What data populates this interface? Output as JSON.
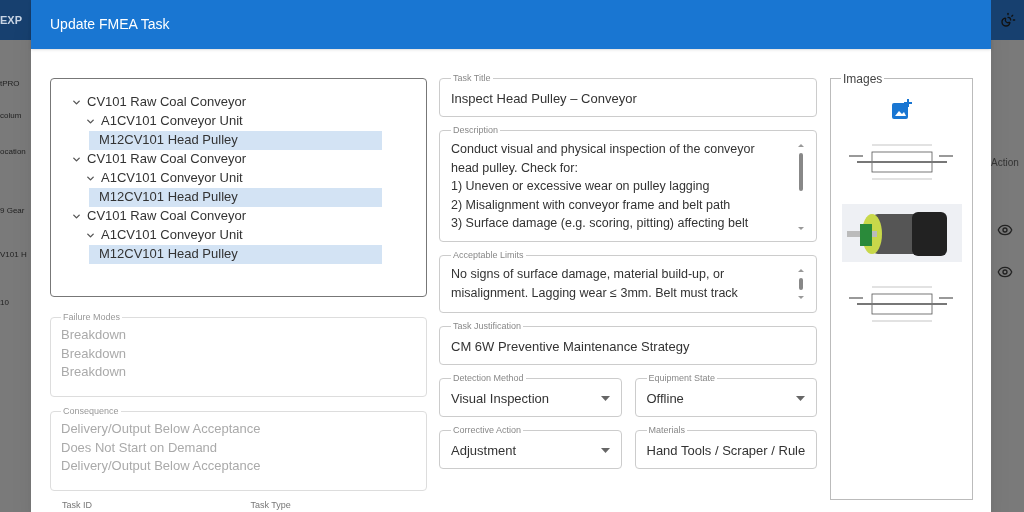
{
  "background": {
    "header_text": "EXP",
    "left_texts": [
      "tPRO",
      "colum",
      "ocation",
      "9 Gear",
      "V101 H",
      "10"
    ],
    "right_texts": [
      "Action"
    ]
  },
  "dialog": {
    "title": "Update FMEA Task"
  },
  "tree": [
    {
      "label": "CV101 Raw Coal Conveyor",
      "expanded": true,
      "selected": false,
      "children": [
        {
          "label": "A1CV101 Conveyor Unit",
          "expanded": true,
          "selected": false,
          "children": [
            {
              "label": "M12CV101 Head Pulley",
              "selected": true
            }
          ]
        }
      ]
    },
    {
      "label": "CV101 Raw Coal Conveyor",
      "expanded": true,
      "selected": false,
      "children": [
        {
          "label": "A1CV101 Conveyor Unit",
          "expanded": true,
          "selected": false,
          "children": [
            {
              "label": "M12CV101 Head Pulley",
              "selected": true
            }
          ]
        }
      ]
    },
    {
      "label": "CV101 Raw Coal Conveyor",
      "expanded": true,
      "selected": false,
      "children": [
        {
          "label": "A1CV101 Conveyor Unit",
          "expanded": true,
          "selected": false,
          "children": [
            {
              "label": "M12CV101 Head Pulley",
              "selected": true
            }
          ]
        }
      ]
    }
  ],
  "failure_modes": {
    "label": "Failure Modes",
    "disabled": true,
    "items": [
      "Breakdown",
      "Breakdown",
      "Breakdown"
    ]
  },
  "consequence": {
    "label": "Consequence",
    "disabled": true,
    "items": [
      "Delivery/Output Below Acceptance",
      "Does Not Start on Demand",
      "Delivery/Output Below Acceptance"
    ]
  },
  "bottom_labels": [
    "Task ID",
    "Task Type"
  ],
  "field_rows": [
    [
      {
        "kind": "text",
        "label": "Task Title",
        "value": "Inspect Head Pulley – Conveyor"
      }
    ],
    [
      {
        "kind": "textarea",
        "label": "Description",
        "lines": [
          "Conduct visual and physical inspection of the conveyor",
          "head pulley. Check for:",
          "1) Uneven or excessive wear on pulley lagging",
          "2) Misalignment with conveyor frame and belt path",
          "3) Surface damage (e.g. scoring, pitting) affecting belt"
        ]
      }
    ],
    [
      {
        "kind": "textarea",
        "label": "Acceptable Limits",
        "lines": [
          "No signs of surface damage, material build-up, or",
          "misalignment. Lagging wear ≤ 3mm. Belt must track"
        ]
      }
    ],
    [
      {
        "kind": "text",
        "label": "Task Justification",
        "value": "CM 6W Preventive Maintenance Strategy"
      }
    ],
    [
      {
        "kind": "select",
        "label": "Detection Method",
        "value": "Visual Inspection"
      },
      {
        "kind": "select",
        "label": "Equipment State",
        "value": "Offline"
      }
    ],
    [
      {
        "kind": "select",
        "label": "Corrective Action",
        "value": "Adjustment"
      },
      {
        "kind": "text",
        "label": "Materials",
        "value": "Hand Tools / Scraper / Rule"
      }
    ]
  ],
  "images": {
    "title": "Images",
    "thumbnails": [
      {
        "kind": "sketch"
      },
      {
        "kind": "photo"
      },
      {
        "kind": "sketch"
      }
    ]
  }
}
